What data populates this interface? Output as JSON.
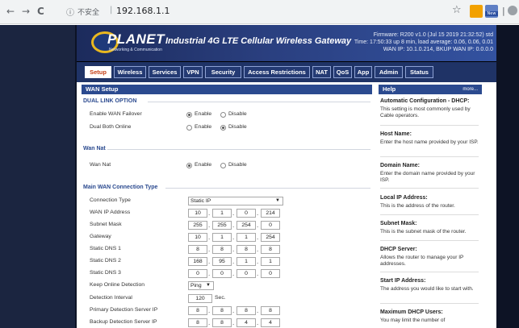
{
  "browser": {
    "back": "←",
    "forward": "→",
    "reload": "C",
    "insecure_label": "不安全",
    "url": "192.168.1.1",
    "star": "☆",
    "new_badge": "New"
  },
  "banner": {
    "logo": "PLANET",
    "logo_sub": "Networking & Communication",
    "title": "Industrial 4G LTE Cellular Wireless Gateway",
    "firmware": "Firmware: R200 v1.0 (Jul 15 2019 21:32:52) std",
    "time": "Time: 17:50:33 up 8 min, load average: 0.06, 0.06, 0.01",
    "wan": "WAN IP: 10.1.0.214, BKUP WAN IP: 0.0.0.0"
  },
  "tabs": [
    "Setup",
    "Wireless",
    "Services",
    "VPN",
    "Security",
    "Access Restrictions",
    "NAT",
    "QoS",
    "App",
    "Admin",
    "Status"
  ],
  "active_tab": "Setup",
  "section_title": "WAN Setup",
  "dual_link": {
    "title": "DUAL LINK OPTION",
    "rows": [
      {
        "label": "Enable WAN Failover",
        "opt1": "Enable",
        "opt2": "Disable",
        "selected": "Enable"
      },
      {
        "label": "Dual Both Online",
        "opt1": "Enable",
        "opt2": "Disable",
        "selected": "Disable"
      }
    ]
  },
  "wan_nat": {
    "title": "Wan Nat",
    "row": {
      "label": "Wan Nat",
      "opt1": "Enable",
      "opt2": "Disable",
      "selected": "Enable"
    }
  },
  "main_wan": {
    "title": "Main WAN Connection Type",
    "connection_type_label": "Connection Type",
    "connection_type_value": "Static IP",
    "ip_rows": [
      {
        "label": "WAN IP Address",
        "octets": [
          "10",
          "1",
          "0",
          "214"
        ]
      },
      {
        "label": "Subnet Mask",
        "octets": [
          "255",
          "255",
          "254",
          "0"
        ]
      },
      {
        "label": "Gateway",
        "octets": [
          "10",
          "1",
          "1",
          "254"
        ]
      },
      {
        "label": "Static DNS 1",
        "octets": [
          "8",
          "8",
          "8",
          "8"
        ]
      },
      {
        "label": "Static DNS 2",
        "octets": [
          "168",
          "95",
          "1",
          "1"
        ]
      },
      {
        "label": "Static DNS 3",
        "octets": [
          "0",
          "0",
          "0",
          "0"
        ]
      }
    ],
    "keep_online_label": "Keep Online Detection",
    "keep_online_value": "Ping",
    "detection_interval_label": "Detection Interval",
    "detection_interval_value": "120",
    "detection_interval_unit": "Sec.",
    "primary_server_label": "Primary Detection Server IP",
    "primary_server_octets": [
      "8",
      "8",
      "8",
      "8"
    ],
    "backup_server_label": "Backup Detection Server IP",
    "backup_server_octets": [
      "8",
      "8",
      "4",
      "4"
    ]
  },
  "help": {
    "title": "Help",
    "more": "more...",
    "items": [
      {
        "title": "Automatic Configuration - DHCP:",
        "text": "This setting is most commonly used by Cable operators."
      },
      {
        "title": "Host Name:",
        "text": "Enter the host name provided by your ISP."
      },
      {
        "title": "Domain Name:",
        "text": "Enter the domain name provided by your ISP."
      },
      {
        "title": "Local IP Address:",
        "text": "This is the address of the router."
      },
      {
        "title": "Subnet Mask:",
        "text": "This is the subnet mask of the router."
      },
      {
        "title": "DHCP Server:",
        "text": "Allows the router to manage your IP addresses."
      },
      {
        "title": "Start IP Address:",
        "text": "The address you would like to start with."
      },
      {
        "title": "Maximum DHCP Users:",
        "text": "You may limit the number of"
      }
    ]
  }
}
